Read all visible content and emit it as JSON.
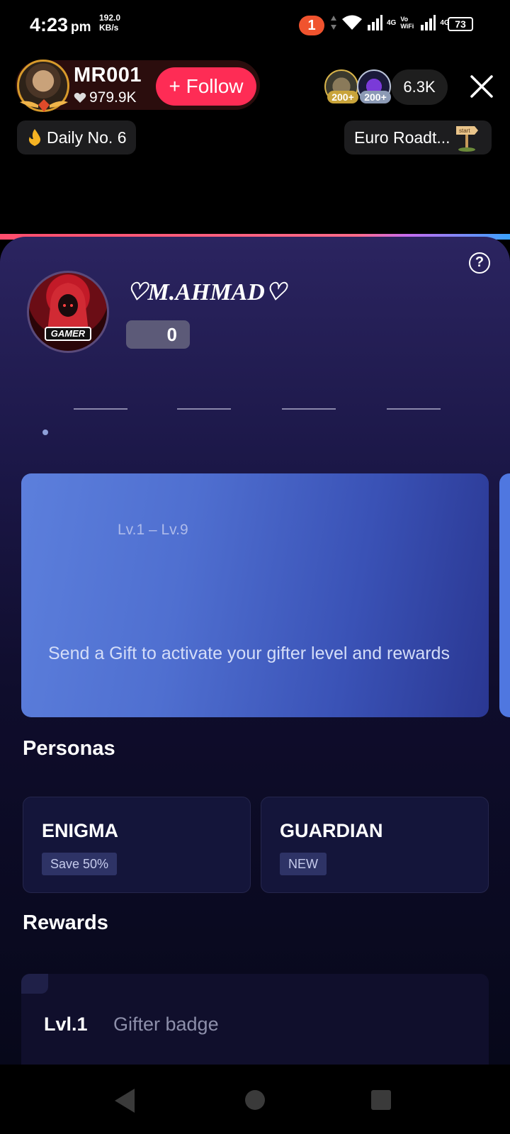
{
  "status_bar": {
    "time": "4:23",
    "time_suffix": "pm",
    "net_speed_value": "192.0",
    "net_speed_unit": "KB/s",
    "notification_count": "1",
    "sim1_label": "4G",
    "volte_label": "Vo WiFi",
    "sim2_label": "4G",
    "battery": "73"
  },
  "live_header": {
    "host_name": "MR001",
    "host_likes": "979.9K",
    "follow_label": "+ Follow",
    "viewer_badges": [
      "200+",
      "200+"
    ],
    "viewer_count": "6.3K",
    "daily_chip": "Daily No. 6",
    "event_chip": "Euro Roadt...",
    "event_icon_text": "start"
  },
  "profile": {
    "username": "♡M.AHMAD♡",
    "score": "0",
    "avatar_label": "GAMER"
  },
  "level_card": {
    "range": "Lv.1 – Lv.9",
    "message": "Send a Gift to activate your gifter level and rewards"
  },
  "personas": {
    "title": "Personas",
    "items": [
      {
        "name": "ENIGMA",
        "tag": "Save 50%"
      },
      {
        "name": "GUARDIAN",
        "tag": "NEW"
      }
    ]
  },
  "rewards": {
    "title": "Rewards",
    "items": [
      {
        "level": "Lvl.1",
        "name": "Gifter badge"
      }
    ]
  },
  "colors": {
    "follow": "#fe2c55",
    "sheet_top": "#2b2460",
    "level_card": "#4f6fd0"
  }
}
